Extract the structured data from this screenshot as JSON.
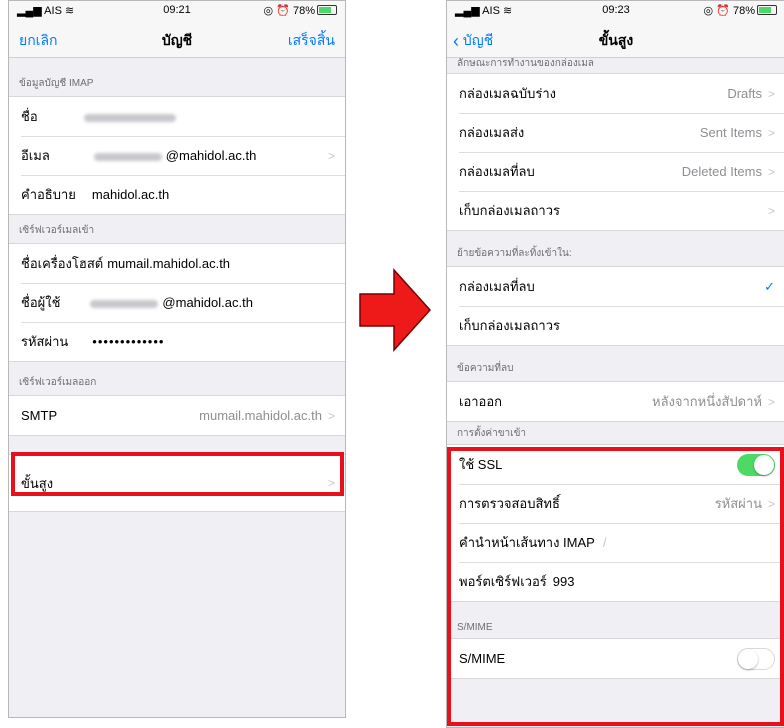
{
  "left": {
    "status": {
      "carrier": "AIS",
      "time": "09:21",
      "right_text": "78%"
    },
    "nav": {
      "cancel": "ยกเลิก",
      "title": "บัญชี",
      "done": "เสร็จสิ้น"
    },
    "section_imap": "ข้อมูลบัญชี IMAP",
    "name_label": "ชื่อ",
    "email_label": "อีเมล",
    "email_suffix": "@mahidol.ac.th",
    "description_label": "คำอธิบาย",
    "description_value": "mahidol.ac.th",
    "section_incoming": "เซิร์ฟเวอร์เมลเข้า",
    "hostname_label": "ชื่อเครื่องโฮสต์",
    "hostname_value": "mumail.mahidol.ac.th",
    "username_label": "ชื่อผู้ใช้",
    "username_suffix": "@mahidol.ac.th",
    "password_label": "รหัสผ่าน",
    "password_value": "•••••••••••••",
    "section_outgoing": "เซิร์ฟเวอร์เมลออก",
    "smtp_label": "SMTP",
    "smtp_value": "mumail.mahidol.ac.th",
    "advanced_label": "ขั้นสูง"
  },
  "right": {
    "status": {
      "carrier": "AIS",
      "time": "09:23",
      "right_text": "78%"
    },
    "nav": {
      "back": "บัญชี",
      "title": "ขั้นสูง"
    },
    "section_mailbox": "ลักษณะการทำงานของกล่องเมล",
    "drafts_label": "กล่องเมลฉบับร่าง",
    "drafts_value": "Drafts",
    "sent_label": "กล่องเมลส่ง",
    "sent_value": "Sent Items",
    "deleted_label": "กล่องเมลที่ลบ",
    "deleted_value": "Deleted Items",
    "archive_label": "เก็บกล่องเมลถาวร",
    "section_move": "ย้ายข้อความที่ละทิ้งเข้าใน:",
    "move_deleted": "กล่องเมลที่ลบ",
    "move_archive": "เก็บกล่องเมลถาวร",
    "section_deleted_msgs": "ข้อความที่ลบ",
    "remove_label": "เอาออก",
    "remove_value": "หลังจากหนึ่งสัปดาห์",
    "section_incoming_settings": "การตั้งค่าขาเข้า",
    "ssl_label": "ใช้ SSL",
    "auth_label": "การตรวจสอบสิทธิ์",
    "auth_value": "รหัสผ่าน",
    "imap_prefix_label": "คำนำหน้าเส้นทาง IMAP",
    "imap_prefix_value": "/",
    "port_label": "พอร์ตเซิร์ฟเวอร์",
    "port_value": "993",
    "section_smime": "S/MIME",
    "smime_label": "S/MIME"
  },
  "colors": {
    "accent": "#007aff",
    "highlight": "#e8101b",
    "toggle_on": "#4cd964"
  }
}
